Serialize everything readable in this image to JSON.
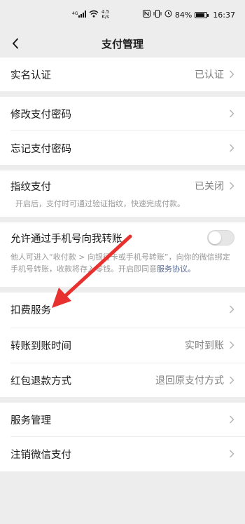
{
  "status_bar": {
    "signal": "4G",
    "net_speed_value": "4.5",
    "net_speed_unit": "K/s",
    "battery_percent": "84%",
    "battery_level": 0.84,
    "time": "16:37"
  },
  "header": {
    "back_icon": "chevron-left-icon",
    "title": "支付管理"
  },
  "sections": {
    "realname": {
      "label": "实名认证",
      "value": "已认证"
    },
    "change_pwd": {
      "label": "修改支付密码"
    },
    "forgot_pwd": {
      "label": "忘记支付密码"
    },
    "fingerprint": {
      "label": "指纹支付",
      "value": "已关闭",
      "hint": "开启后，支付时可通过验证指纹，快速完成付款。"
    },
    "phone_transfer": {
      "label": "允许通过手机号向我转账",
      "toggle_on": false,
      "hint": "他人可进入“收付款 > 向银行卡或手机号转账”，向你的微信绑定手机号转账，收款将存入零钱。开启即同意",
      "hint_link": "服务协议。"
    },
    "deduction": {
      "label": "扣费服务"
    },
    "arrival_time": {
      "label": "转账到账时间",
      "value": "实时到账"
    },
    "hongbao_refund": {
      "label": "红包退款方式",
      "value": "退回原支付方式"
    },
    "service_mgmt": {
      "label": "服务管理"
    },
    "cancel_pay": {
      "label": "注销微信支付"
    }
  },
  "colors": {
    "background": "#ededed",
    "card": "#ffffff",
    "link": "#576b95",
    "annotation_arrow": "#e8302f"
  }
}
